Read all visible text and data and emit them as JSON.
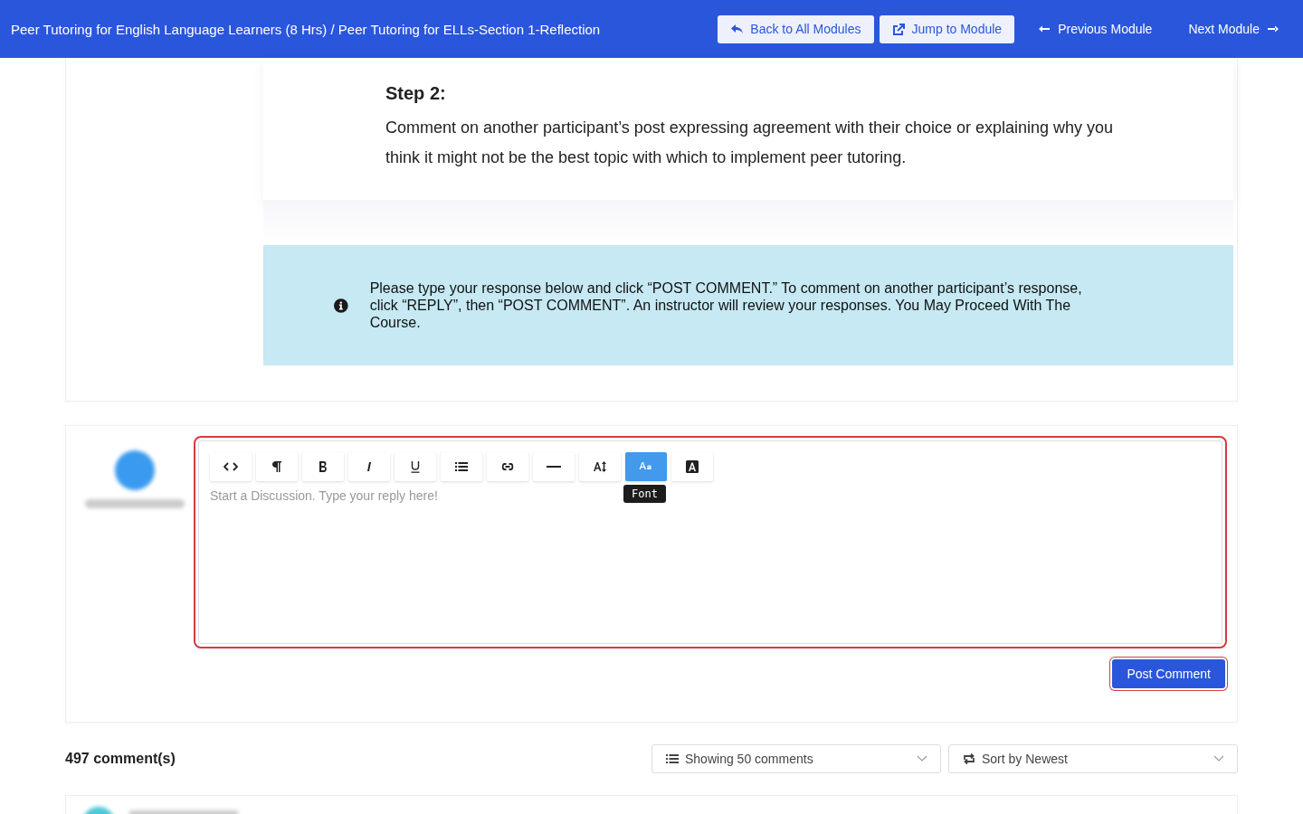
{
  "header": {
    "breadcrumb": "Peer Tutoring for English Language Learners (8 Hrs) / Peer Tutoring for ELLs-Section 1-Reflection",
    "buttons": [
      {
        "kind": "back",
        "label": "Back to All Modules"
      },
      {
        "kind": "jump",
        "label": "Jump to Module"
      },
      {
        "kind": "prev",
        "label": "Previous Module"
      },
      {
        "kind": "next",
        "label": "Next Module"
      }
    ]
  },
  "step": {
    "title": "Step 2:",
    "text": "Comment on another participant’s post expressing agreement with their choice or explaining why you think it might not be the best topic with which to implement peer tutoring."
  },
  "notice": {
    "text": "Please type your response below and click “POST COMMENT.”  To comment on another participant’s response, click “REPLY”, then “POST COMMENT”.  An instructor will review your responses. You May Proceed With The Course."
  },
  "editor": {
    "tools": [
      {
        "kind": "code",
        "selected": false
      },
      {
        "kind": "paragraph",
        "selected": false
      },
      {
        "kind": "bold",
        "selected": false
      },
      {
        "kind": "italic",
        "selected": false
      },
      {
        "kind": "underline",
        "selected": false
      },
      {
        "kind": "list",
        "selected": false
      },
      {
        "kind": "link",
        "selected": false
      },
      {
        "kind": "rule",
        "selected": false
      },
      {
        "kind": "size",
        "selected": false
      },
      {
        "kind": "font",
        "selected": true
      },
      {
        "kind": "color",
        "selected": false
      }
    ],
    "tooltip": "Font",
    "placeholder": "Start a Discussion. Type your reply here!",
    "submit": "Post Comment"
  },
  "comments": {
    "count": "497 comment(s)",
    "show": "Showing 50 comments",
    "sort": "Sort by Newest"
  }
}
